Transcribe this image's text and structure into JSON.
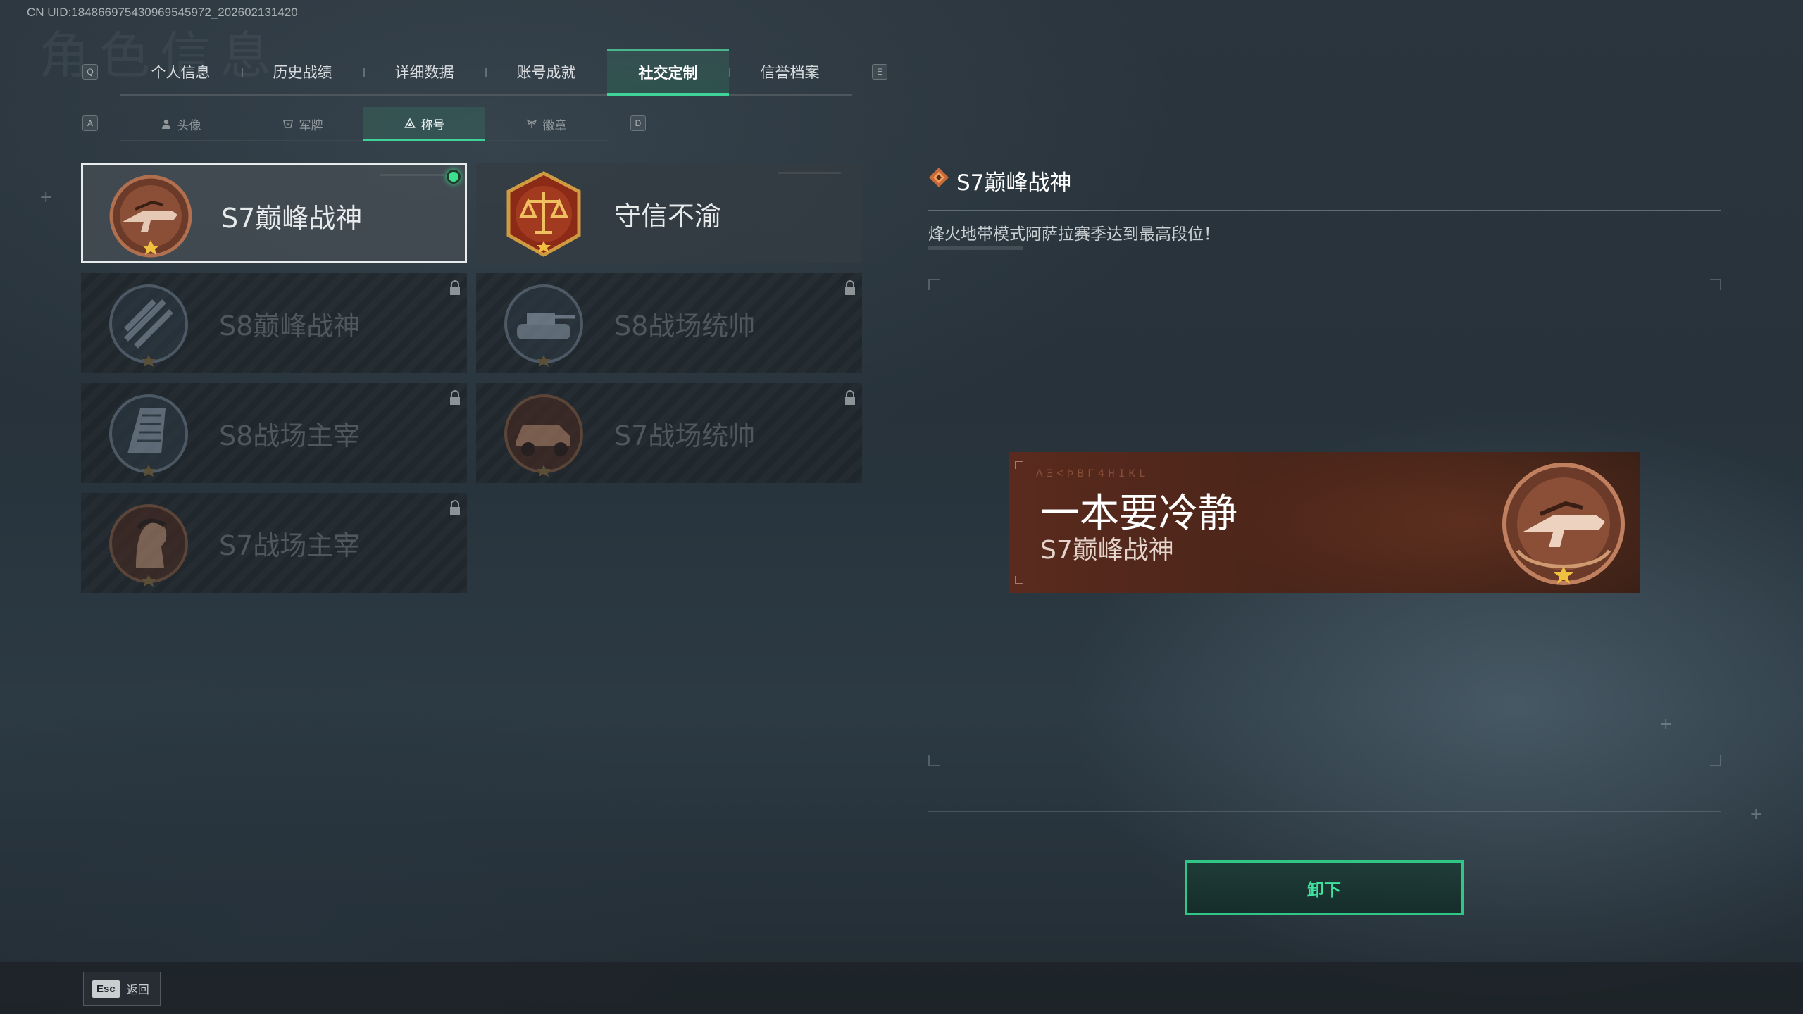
{
  "uid_text": "CN UID:1848669754309695459​72_202602131420",
  "ghost_title": "角色信息",
  "main_tabs": {
    "left_key": "Q",
    "right_key": "E",
    "items": [
      {
        "label": "个人信息",
        "active": false
      },
      {
        "label": "历史战绩",
        "active": false
      },
      {
        "label": "详细数据",
        "active": false
      },
      {
        "label": "账号成就",
        "active": false
      },
      {
        "label": "社交定制",
        "active": true
      },
      {
        "label": "信誉档案",
        "active": false
      }
    ]
  },
  "sub_tabs": {
    "left_key": "A",
    "right_key": "D",
    "items": [
      {
        "label": "头像",
        "icon": "person-icon",
        "active": false
      },
      {
        "label": "军牌",
        "icon": "tag-icon",
        "active": false
      },
      {
        "label": "称号",
        "icon": "triangle-icon",
        "active": true
      },
      {
        "label": "徽章",
        "icon": "wings-icon",
        "active": false
      }
    ]
  },
  "titles": [
    {
      "label": "S7巅峰战神",
      "emblem": "gun-emblem-icon",
      "locked": false,
      "selected": true,
      "equipped": true
    },
    {
      "label": "守信不渝",
      "emblem": "scales-emblem-icon",
      "locked": false,
      "selected": false,
      "equipped": false
    },
    {
      "label": "S8巅峰战神",
      "emblem": "slash-emblem-icon",
      "locked": true,
      "selected": false,
      "equipped": false
    },
    {
      "label": "S8战场统帅",
      "emblem": "tank-emblem-icon",
      "locked": true,
      "selected": false,
      "equipped": false
    },
    {
      "label": "S8战场主宰",
      "emblem": "building-emblem-icon",
      "locked": true,
      "selected": false,
      "equipped": false
    },
    {
      "label": "S7战场统帅",
      "emblem": "vehicle-emblem-icon",
      "locked": true,
      "selected": false,
      "equipped": false
    },
    {
      "label": "S7战场主宰",
      "emblem": "soldier-emblem-icon",
      "locked": true,
      "selected": false,
      "equipped": false
    }
  ],
  "detail": {
    "title": "S7巅峰战神",
    "description": "烽火地带模式阿萨拉赛季达到最高段位！"
  },
  "preview": {
    "bg_text": "ΛΞ<ÞΒΓ4ΗΙΚL",
    "player_name": "一本要冷静",
    "title": "S7巅峰战神"
  },
  "action_button": "卸下",
  "footer": {
    "esc_key": "Esc",
    "esc_label": "返回"
  },
  "colors": {
    "accent": "#3fd39a",
    "equipped_dot": "#3de08e",
    "banner": "#5a2a1e",
    "bronze": "#b07050"
  }
}
